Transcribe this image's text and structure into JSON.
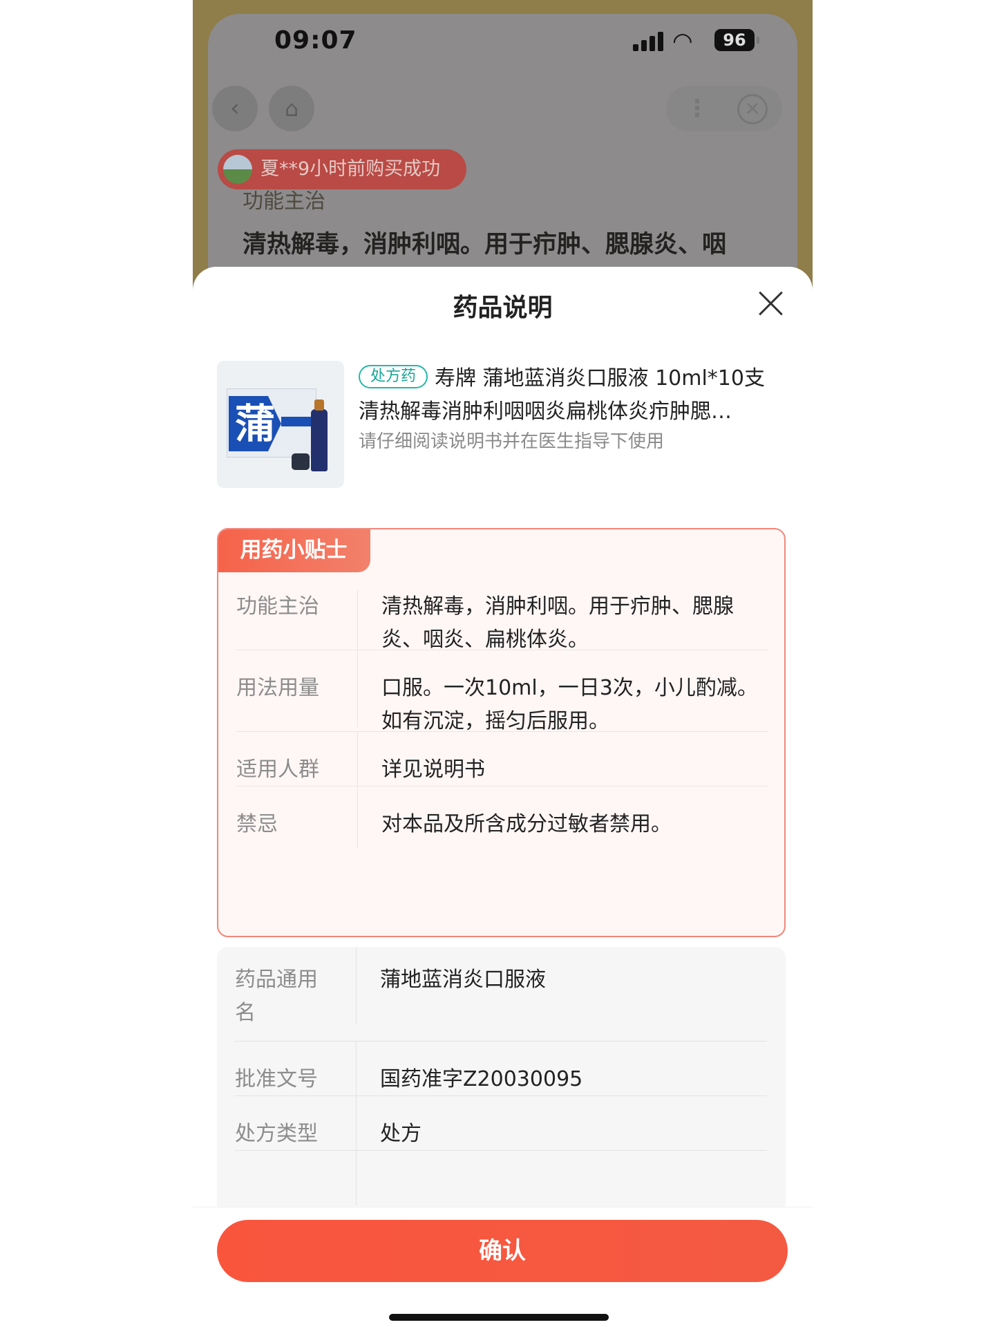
{
  "status_bar": {
    "time": "09:07",
    "battery": "96"
  },
  "background_page": {
    "toast": "夏**9小时前购买成功",
    "section_label": "功能主治",
    "section_text": "清热解毒，消肿利咽。用于疖肿、腮腺炎、咽"
  },
  "sheet": {
    "title": "药品说明",
    "product": {
      "rx_tag": "处方药",
      "name": "寿牌 蒲地蓝消炎口服液 10ml*10支",
      "description": "清热解毒消肿利咽咽炎扁桃体炎疖肿腮…",
      "tip": "请仔细阅读说明书并在医生指导下使用",
      "image_char": "蒲"
    },
    "tips_card": {
      "badge": "用药小贴士",
      "rows": [
        {
          "label": "功能主治",
          "value": "清热解毒，消肿利咽。用于疖肿、腮腺炎、咽炎、扁桃体炎。"
        },
        {
          "label": "用法用量",
          "value": "口服。一次10ml，一日3次，小儿酌减。如有沉淀，摇匀后服用。"
        },
        {
          "label": "适用人群",
          "value": "详见说明书"
        },
        {
          "label": "禁忌",
          "value": "对本品及所含成分过敏者禁用。"
        }
      ]
    },
    "info_card": {
      "rows": [
        {
          "label": "药品通用名",
          "value": "蒲地蓝消炎口服液"
        },
        {
          "label": "批准文号",
          "value": "国药准字Z20030095"
        },
        {
          "label": "处方类型",
          "value": "处方"
        }
      ]
    },
    "confirm_label": "确认"
  },
  "colors": {
    "accent": "#f9553d",
    "rx_tag": "#22b7a8",
    "tips_border": "#f2867a"
  }
}
